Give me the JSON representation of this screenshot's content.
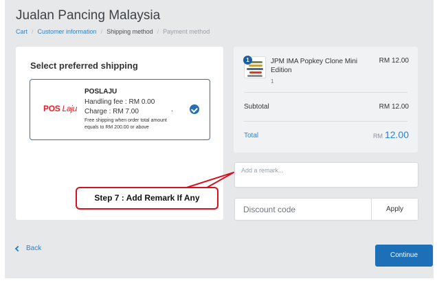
{
  "store": {
    "title": "Jualan Pancing Malaysia"
  },
  "breadcrumb": {
    "cart": "Cart",
    "customer_information": "Customer information",
    "shipping_method": "Shipping method",
    "payment_method": "Payment method",
    "separator": "/"
  },
  "shipping": {
    "heading": "Select preferred shipping",
    "option": {
      "logo_pos": "POS",
      "logo_laju": "Laju",
      "name": "POSLAJU",
      "handling_fee": "Handling fee : RM 0.00",
      "charge": "Charge : RM 7.00",
      "dot": ".",
      "note": "Free shipping when order total amount equals to RM 200.00 or above",
      "selected": true
    }
  },
  "summary": {
    "item": {
      "name": "JPM IMA Popkey Clone Mini Edition",
      "quantity": "1",
      "badge": "1",
      "price": "RM 12.00",
      "thumbnail_icon": "fishing-lure-image"
    },
    "subtotal_label": "Subtotal",
    "subtotal_value": "RM 12.00",
    "total_label": "Total",
    "total_currency": "RM",
    "total_value": "12.00"
  },
  "remark": {
    "placeholder": "Add a remark..."
  },
  "discount": {
    "placeholder": "Discount code",
    "apply_label": "Apply"
  },
  "annotation": {
    "text": "Step 7 : Add Remark If Any",
    "color": "#d7101d"
  },
  "footer": {
    "back_label": "Back",
    "continue_label": "Continue"
  },
  "colors": {
    "accent": "#1d6fb8",
    "link": "#2c83c8",
    "brand_red": "#e21f26"
  }
}
